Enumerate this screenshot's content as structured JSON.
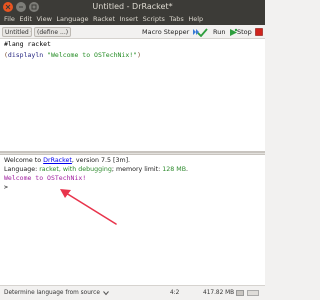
{
  "window": {
    "title": "Untitled - DrRacket*"
  },
  "menubar": {
    "items": [
      "File",
      "Edit",
      "View",
      "Language",
      "Racket",
      "Insert",
      "Scripts",
      "Tabs",
      "Help"
    ]
  },
  "toolbar": {
    "file_selector": "Untitled ▾",
    "define_selector": "(define ...) ▾",
    "macro_stepper": "Macro Stepper",
    "check_syntax": "",
    "run": "Run",
    "stop": "Stop"
  },
  "definitions": {
    "line1_hash": "#lang racket",
    "line2_open": "(",
    "line2_fn": "displayln",
    "line2_str": "\"Welcome to OSTechNix!\"",
    "line2_close": ")"
  },
  "interactions": {
    "welcome_prefix": "Welcome to ",
    "welcome_link": "DrRacket",
    "welcome_suffix": ", version 7.5 [3m].",
    "language_prefix": "Language: ",
    "language_name": "racket, with debugging",
    "language_mid": "; memory limit: ",
    "memory_limit": "128 MB",
    "language_end": ".",
    "output": "Welcome to OSTechNix!",
    "prompt": ">"
  },
  "statusbar": {
    "language_selector": "Determine language from source",
    "position": "4:2",
    "memory": "417.82 MB"
  },
  "colors": {
    "titlebar": "#3c3b37",
    "close_button": "#e95420",
    "output_text": "#a020a0",
    "string_literal": "#228b22",
    "link": "#0000ee",
    "annotation_arrow": "#e8344c"
  }
}
